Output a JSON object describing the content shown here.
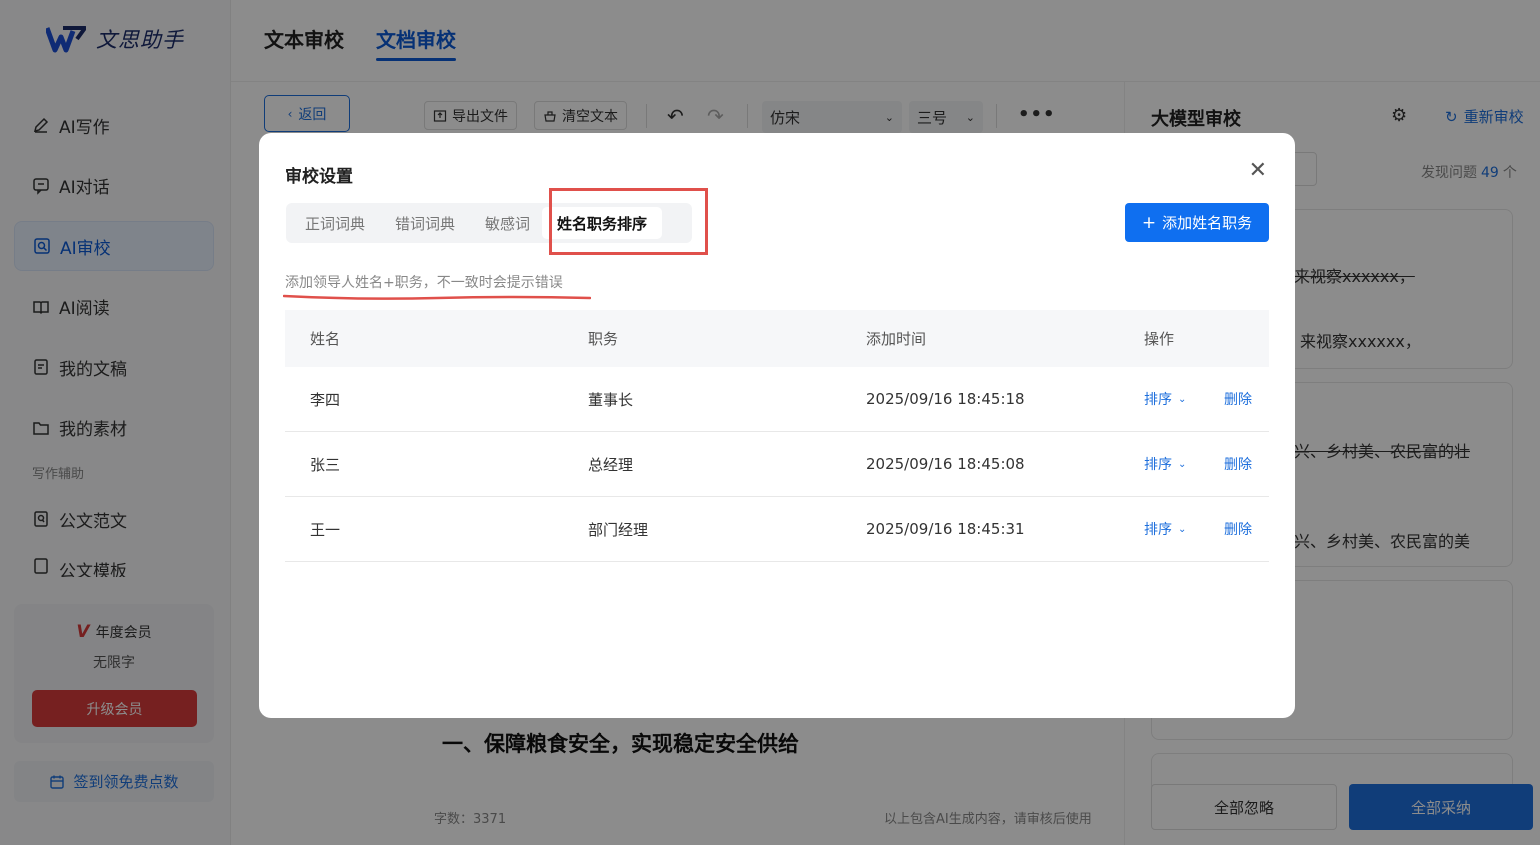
{
  "app": {
    "name": "文思助手"
  },
  "sidebar": {
    "items": [
      {
        "label": "AI写作",
        "icon": "pen-icon"
      },
      {
        "label": "AI对话",
        "icon": "chat-icon"
      },
      {
        "label": "AI审校",
        "icon": "proofread-icon",
        "active": true
      },
      {
        "label": "AI阅读",
        "icon": "book-icon"
      },
      {
        "label": "我的文稿",
        "icon": "document-icon"
      },
      {
        "label": "我的素材",
        "icon": "folder-icon"
      }
    ],
    "section_label": "写作辅助",
    "section_items": [
      {
        "label": "公文范文",
        "icon": "template-icon"
      },
      {
        "label": "公文模板",
        "icon": "template2-icon"
      }
    ],
    "member": {
      "title": "年度会员",
      "sub": "无限字",
      "upgrade": "升级会员"
    },
    "signin": "签到领免费点数"
  },
  "top_tabs": [
    {
      "label": "文本审校"
    },
    {
      "label": "文档审校",
      "active": true
    }
  ],
  "toolbar": {
    "back": "返回",
    "export": "导出文件",
    "clear": "清空文本",
    "font": "仿宋",
    "size": "三号"
  },
  "document": {
    "heading": "一、保障粮食安全，实现稳定安全供给",
    "word_count": "字数：3371",
    "ai_note": "以上包含AI生成内容，请审核后使用"
  },
  "right_panel": {
    "title": "大模型审校",
    "recheck": "重新审校",
    "found_label": "发现问题",
    "found_count": "49",
    "found_unit": "个",
    "snippets": [
      "来视察xxxxxx，",
      "，来视察xxxxxx，",
      "兴、乡村美、农民富的壮",
      "兴、乡村美、农民富的美"
    ],
    "ignore_all": "全部忽略",
    "adopt_all": "全部采纳"
  },
  "modal": {
    "title": "审校设置",
    "tabs": [
      {
        "label": "正词词典"
      },
      {
        "label": "错词词典"
      },
      {
        "label": "敏感词"
      },
      {
        "label": "姓名职务排序",
        "active": true
      }
    ],
    "add_button": "添加姓名职务",
    "hint": "添加领导人姓名+职务，不一致时会提示错误",
    "columns": [
      "姓名",
      "职务",
      "添加时间",
      "操作"
    ],
    "rows": [
      {
        "name": "李四",
        "title": "董事长",
        "time": "2025/09/16 18:45:18",
        "sort": "排序",
        "delete": "删除"
      },
      {
        "name": "张三",
        "title": "总经理",
        "time": "2025/09/16 18:45:08",
        "sort": "排序",
        "delete": "删除"
      },
      {
        "name": "王一",
        "title": "部门经理",
        "time": "2025/09/16 18:45:31",
        "sort": "排序",
        "delete": "删除"
      }
    ]
  },
  "colors": {
    "primary": "#0f6ff0",
    "annotation_red": "#e0504b",
    "upgrade_red": "#d83b3b"
  }
}
